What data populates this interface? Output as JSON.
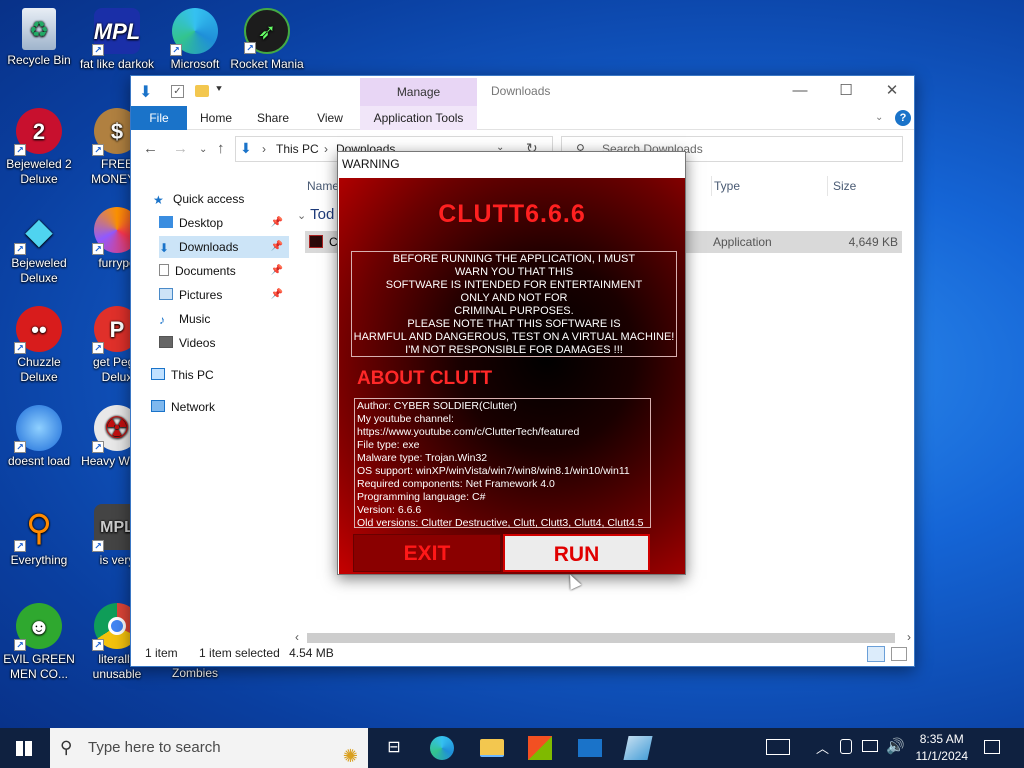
{
  "desktop": {
    "icons": [
      {
        "label": "Recycle Bin"
      },
      {
        "label": "fat like darkok"
      },
      {
        "label": "Microsoft"
      },
      {
        "label": "Rocket Mania"
      },
      {
        "label": "Bejeweled 2 Deluxe"
      },
      {
        "label": "FREE MONEY.c"
      },
      {
        "label": "Bejeweled Deluxe"
      },
      {
        "label": "furrypo"
      },
      {
        "label": "Chuzzle Deluxe"
      },
      {
        "label": "get Pegg Delux"
      },
      {
        "label": "doesnt load"
      },
      {
        "label": "Heavy Weap."
      },
      {
        "label": "Everything"
      },
      {
        "label": "is very"
      },
      {
        "label": "EVIL GREEN MEN CO..."
      },
      {
        "label": "literally unusable"
      },
      {
        "label": "Zombies"
      }
    ]
  },
  "explorer": {
    "title": "Downloads",
    "manage_tab": "Manage",
    "ribbon_tabs": [
      "File",
      "Home",
      "Share",
      "View",
      "Application Tools"
    ],
    "breadcrumb": [
      "This PC",
      "Downloads"
    ],
    "search_placeholder": "Search Downloads",
    "nav": [
      {
        "label": "Quick access"
      },
      {
        "label": "Desktop"
      },
      {
        "label": "Downloads"
      },
      {
        "label": "Documents"
      },
      {
        "label": "Pictures"
      },
      {
        "label": "Music"
      },
      {
        "label": "Videos"
      },
      {
        "label": "This PC"
      },
      {
        "label": "Network"
      }
    ],
    "columns": {
      "name": "Name",
      "type": "Type",
      "size": "Size"
    },
    "group_label": "Tod",
    "file": {
      "name": "C",
      "type": "Application",
      "size": "4,649 KB"
    },
    "status": {
      "items": "1 item",
      "selected": "1 item selected",
      "sel_size": "4.54 MB"
    }
  },
  "dialog": {
    "title": "WARNING",
    "heading": "CLUTT6.6.6",
    "warning_lines": [
      "BEFORE RUNNING THE APPLICATION, I MUST",
      "WARN YOU THAT THIS",
      "SOFTWARE IS INTENDED FOR ENTERTAINMENT",
      "ONLY AND NOT FOR",
      "CRIMINAL PURPOSES.",
      "PLEASE NOTE THAT THIS SOFTWARE IS",
      "HARMFUL AND DANGEROUS, TEST ON A VIRTUAL MACHINE!",
      "I'M NOT RESPONSIBLE FOR DAMAGES !!!"
    ],
    "about_heading": "ABOUT CLUTT",
    "info_lines": [
      "Author: CYBER SOLDIER(Clutter)",
      "My youtube channel:",
      "https://www.youtube.com/c/ClutterTech/featured",
      "File type: exe",
      "Malware type: Trojan.Win32",
      "OS support: winXP/winVista/win7/win8/win8.1/win10/win11",
      "Required components: Net Framework 4.0",
      "Programming language: C#",
      "Version: 6.6.6",
      "Old versions: Clutter Destructive, Clutt, Clutt3, Clutt4, Clutt4.5"
    ],
    "exit_label": "EXIT",
    "run_label": "RUN"
  },
  "taskbar": {
    "search_placeholder": "Type here to search",
    "time": "8:35 AM",
    "date": "11/1/2024"
  }
}
